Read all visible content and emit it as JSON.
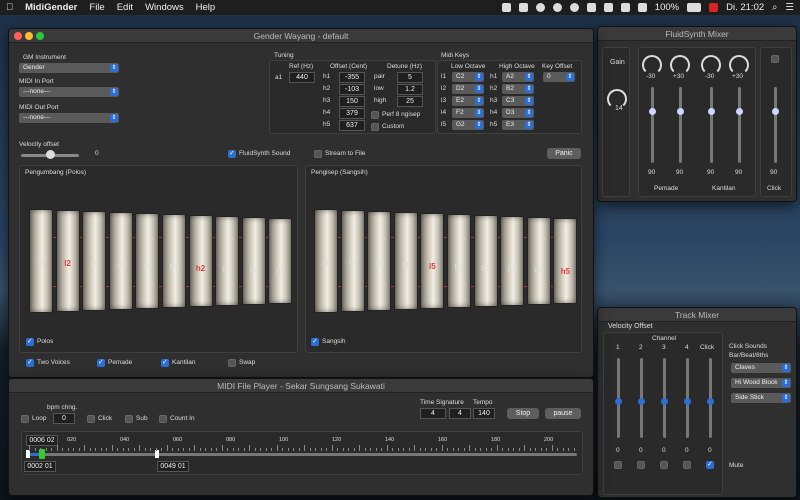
{
  "menubar": {
    "app": "MidiGender",
    "items": [
      "File",
      "Edit",
      "Windows",
      "Help"
    ],
    "battery": "100%",
    "clock": "Di. 21:02"
  },
  "main": {
    "title": "Gender Wayang - default",
    "gm_label": "GM Instrument",
    "gm_value": "Gender",
    "midi_in_label": "MIDI In Port",
    "midi_in_value": "---none---",
    "midi_out_label": "MIDI Out Port",
    "midi_out_value": "---none---",
    "tuning": {
      "title": "Tuning",
      "ref_hdr": "Ref (Hz)",
      "off_hdr": "Offset (Cent)",
      "det_hdr": "Detune (Hz)",
      "ref_note": "a1",
      "ref_val": "440",
      "rows": [
        {
          "k": "h1",
          "v": "-355"
        },
        {
          "k": "h2",
          "v": "-103"
        },
        {
          "k": "h3",
          "v": "150"
        },
        {
          "k": "h4",
          "v": "379"
        },
        {
          "k": "h5",
          "v": "637"
        }
      ],
      "det": [
        {
          "k": "pair",
          "v": "5"
        },
        {
          "k": "low",
          "v": "1.2"
        },
        {
          "k": "high",
          "v": "25"
        }
      ],
      "perf": "Perf 8 ngisep",
      "custom": "Custom"
    },
    "midikeys": {
      "title": "Midi Keys",
      "low": "Low Octave",
      "high": "High Octave",
      "offset": "Key Offset",
      "offset_val": "0",
      "low_rows": [
        {
          "k": "l1",
          "v": "C2"
        },
        {
          "k": "l2",
          "v": "D2"
        },
        {
          "k": "l3",
          "v": "E2"
        },
        {
          "k": "l4",
          "v": "F2"
        },
        {
          "k": "l5",
          "v": "G2"
        }
      ],
      "high_rows": [
        {
          "k": "h1",
          "v": "A2"
        },
        {
          "k": "h2",
          "v": "B2"
        },
        {
          "k": "h3",
          "v": "C3"
        },
        {
          "k": "h4",
          "v": "D3"
        },
        {
          "k": "h5",
          "v": "E3"
        }
      ]
    },
    "velocity_label": "Velocity offset",
    "velocity_value": "0",
    "fluidsynth_sound": "FluidSynth Sound",
    "stream_to_file": "Stream to File",
    "panic": "Panic",
    "pengumbang_title": "Pengumbang (Polos)",
    "pengisep_title": "Pengisep (Sangsih)",
    "bars_left": [
      {
        "t": "l1",
        "c": "#ddd"
      },
      {
        "t": "l2",
        "c": "#e04040"
      },
      {
        "t": "l3",
        "c": "#ddd"
      },
      {
        "t": "l4",
        "c": "#ddd"
      },
      {
        "t": "l5",
        "c": "#ddd"
      },
      {
        "t": "h1",
        "c": "#ddd"
      },
      {
        "t": "h2",
        "c": "#e04040"
      },
      {
        "t": "h3",
        "c": "#ddd"
      },
      {
        "t": "h4",
        "c": "#ddd"
      },
      {
        "t": "h5",
        "c": "#ddd"
      }
    ],
    "bars_right": [
      {
        "t": "l1",
        "c": "#ddd"
      },
      {
        "t": "l2",
        "c": "#ddd"
      },
      {
        "t": "l3",
        "c": "#ddd"
      },
      {
        "t": "l4",
        "c": "#ddd"
      },
      {
        "t": "l5",
        "c": "#e04040"
      },
      {
        "t": "h1",
        "c": "#ddd"
      },
      {
        "t": "h2",
        "c": "#ddd"
      },
      {
        "t": "h3",
        "c": "#ddd"
      },
      {
        "t": "h4",
        "c": "#ddd"
      },
      {
        "t": "h5",
        "c": "#e04040"
      }
    ],
    "polos": "Polos",
    "sangsih": "Sangsih",
    "two_voices": "Two Voices",
    "pemade": "Pemade",
    "kantilan": "Kantilan",
    "swap": "Swap"
  },
  "fluid": {
    "title": "FluidSynth Mixer",
    "gain": "Gain",
    "gain_val": "14",
    "pans": [
      "-30",
      "+30",
      "-30",
      "+30"
    ],
    "vals": [
      "90",
      "90",
      "90",
      "90",
      "90"
    ],
    "pemade": "Pemade",
    "kantilan": "Kantilan",
    "click": "Click",
    "levels": [
      0.72,
      0.72,
      0.72,
      0.72,
      0.72
    ]
  },
  "track": {
    "title": "Track Mixer",
    "velocity_offset": "Velocity Offset",
    "channel": "Channel",
    "cols": [
      "1",
      "2",
      "3",
      "4",
      "Click"
    ],
    "vals": [
      "0",
      "0",
      "0",
      "0",
      "0"
    ],
    "click_sounds": "Click Sounds Bar/Beat/8ths",
    "sounds": [
      "Claves",
      "Hi Wood Block",
      "Side Stick"
    ],
    "mute": "Mute",
    "levels": [
      0.5,
      0.5,
      0.5,
      0.5,
      0.5
    ]
  },
  "player": {
    "title": "MIDI File Player - Sekar Sungsang Sukawati",
    "bpm": "bpm chng.",
    "bpm_val": "0",
    "loop": "Loop",
    "click": "Click",
    "sub": "Sub",
    "count_in": "Count In",
    "timesig": "Time Signature",
    "tempo": "Tempo",
    "ts1": "4",
    "ts2": "4",
    "tempo_val": "140",
    "stop": "Stop",
    "pause": "pause",
    "pos_top": "0006 02",
    "pos_start": "0002 01",
    "pos_end": "0049 01",
    "ticks": [
      "020",
      "040",
      "060",
      "080",
      "100",
      "120",
      "140",
      "160",
      "180",
      "200"
    ]
  }
}
